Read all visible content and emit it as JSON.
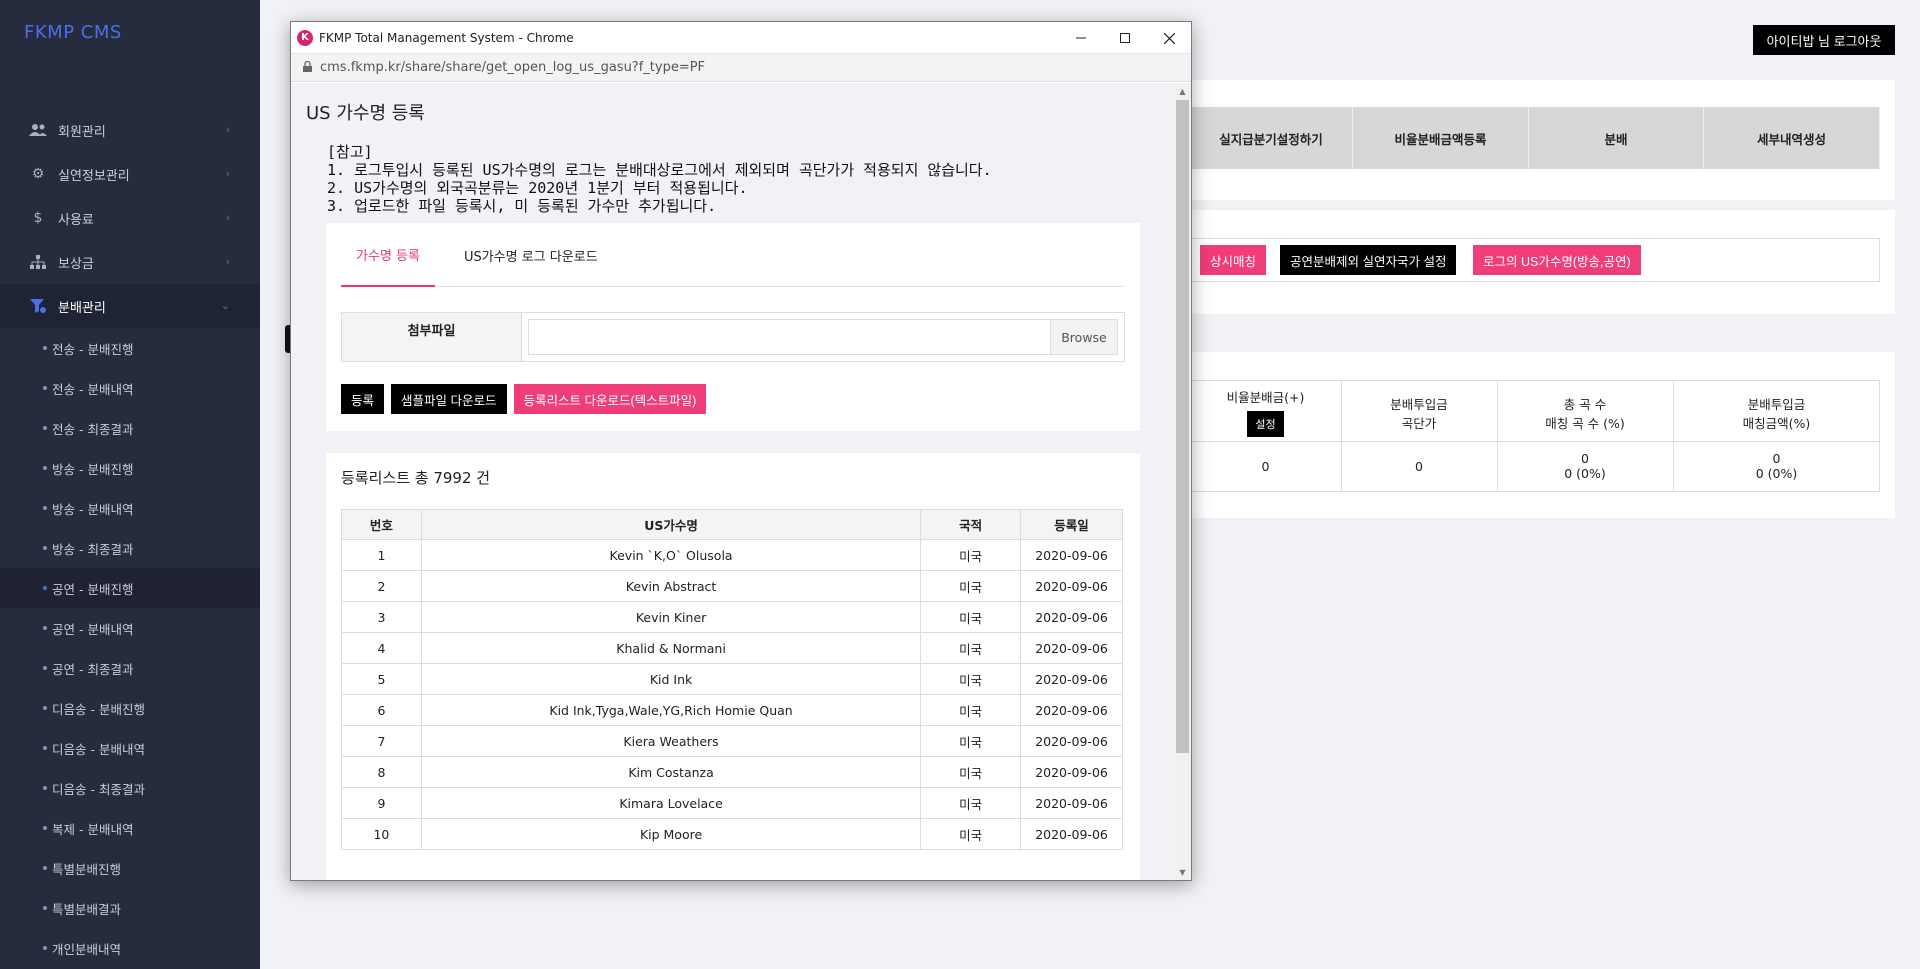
{
  "sidebar": {
    "brand": "FKMP CMS",
    "menu": [
      {
        "label": "회원관리"
      },
      {
        "label": "실연정보관리"
      },
      {
        "label": "사용료"
      },
      {
        "label": "보상금"
      },
      {
        "label": "분배관리"
      }
    ],
    "submenu": [
      "전송 - 분배진행",
      "전송 - 분배내역",
      "전송 - 최종결과",
      "방송 - 분배진행",
      "방송 - 분배내역",
      "방송 - 최종결과",
      "공연 - 분배진행",
      "공연 - 분배내역",
      "공연 - 최종결과",
      "디음송 - 분배진행",
      "디음송 - 분배내역",
      "디음송 - 최종결과",
      "복제 - 분배내역",
      "특별분배진행",
      "특별분배결과",
      "개인분배내역"
    ]
  },
  "header": {
    "logout": "아이티밥  님 로그아웃"
  },
  "background": {
    "steps": [
      "실지급분기설정하기",
      "비율분배금액등록",
      "분배",
      "세부내역생성"
    ],
    "buttons": [
      "상시매칭",
      "공연분배제외 실연자국가 설정",
      "로그의 US가수명(방송,공연)"
    ],
    "stats_headers": [
      {
        "line1": "비율분배금(+)",
        "btn": "설정"
      },
      {
        "line1": "분배투입금",
        "line2": "곡단가"
      },
      {
        "line1": "총 곡 수",
        "line2": "매칭 곡 수 (%)"
      },
      {
        "line1": "분배투입금",
        "line2": "매칭금액(%)"
      }
    ],
    "stats_values": [
      {
        "line1": "0"
      },
      {
        "line1": "0"
      },
      {
        "line1": "0",
        "line2": "0 (0%)"
      },
      {
        "line1": "0",
        "line2": "0 (0%)"
      }
    ]
  },
  "popup": {
    "window_title": "FKMP Total Management System - Chrome",
    "url": "cms.fkmp.kr/share/share/get_open_log_us_gasu?f_type=PF",
    "heading": "US 가수명 등록",
    "notice": [
      "[참고]",
      "1. 로그투입시 등록된 US가수명의 로그는 분배대상로그에서 제외되며 곡단가가 적용되지 않습니다.",
      "2. US가수명의 외국곡분류는 2020년 1분기 부터 적용됩니다.",
      "3. 업로드한 파일 등록시, 미 등록된 가수만 추가됩니다."
    ],
    "tabs": [
      "가수명 등록",
      "US가수명 로그 다운로드"
    ],
    "file_label": "첨부파일",
    "browse": "Browse",
    "btn_register": "등록",
    "btn_sample": "샘플파일 다운로드",
    "btn_list_download": "등록리스트 다운로드(텍스트파일)",
    "list_title": "등록리스트 총 7992 건",
    "columns": [
      "번호",
      "US가수명",
      "국적",
      "등록일"
    ],
    "rows": [
      [
        "1",
        "Kevin `K,O` Olusola",
        "미국",
        "2020-09-06"
      ],
      [
        "2",
        "Kevin Abstract",
        "미국",
        "2020-09-06"
      ],
      [
        "3",
        "Kevin Kiner",
        "미국",
        "2020-09-06"
      ],
      [
        "4",
        "Khalid & Normani",
        "미국",
        "2020-09-06"
      ],
      [
        "5",
        "Kid Ink",
        "미국",
        "2020-09-06"
      ],
      [
        "6",
        "Kid Ink,Tyga,Wale,YG,Rich Homie Quan",
        "미국",
        "2020-09-06"
      ],
      [
        "7",
        "Kiera Weathers",
        "미국",
        "2020-09-06"
      ],
      [
        "8",
        "Kim Costanza",
        "미국",
        "2020-09-06"
      ],
      [
        "9",
        "Kimara Lovelace",
        "미국",
        "2020-09-06"
      ],
      [
        "10",
        "Kip Moore",
        "미국",
        "2020-09-06"
      ]
    ]
  },
  "colors": {
    "accent_pink": "#ee3d7a",
    "sidebar_bg": "#262c3e",
    "brand_blue": "#4c6ee8"
  }
}
